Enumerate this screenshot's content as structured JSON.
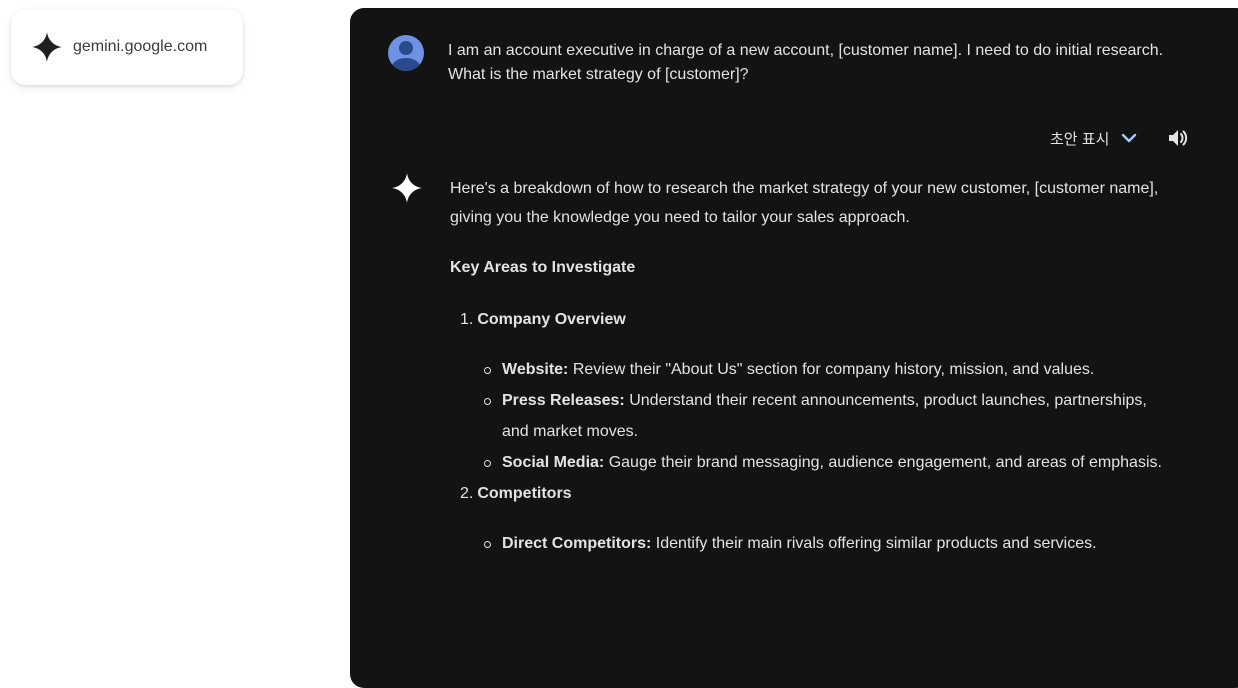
{
  "site_chip": {
    "icon": "gemini-spark-icon",
    "domain": "gemini.google.com"
  },
  "conversation": {
    "user_prompt": "I am an account executive in charge of a new account, [customer name]. I need to do initial research. What is the market strategy of [customer]?",
    "draft_label": "초안 표시",
    "response": {
      "intro": "Here's a breakdown of how to research the market strategy of your new customer, [customer name], giving you the knowledge you need to tailor your sales approach.",
      "heading": "Key Areas to Investigate",
      "sections": [
        {
          "number": "1.",
          "title": "Company Overview",
          "bullets": [
            {
              "term": "Website:",
              "text": " Review their \"About Us\" section for company history, mission, and values."
            },
            {
              "term": "Press Releases:",
              "text": " Understand their recent announcements, product launches, partnerships, and market moves."
            },
            {
              "term": "Social Media:",
              "text": " Gauge their brand messaging, audience engagement, and areas of emphasis."
            }
          ]
        },
        {
          "number": "2.",
          "title": "Competitors",
          "bullets": [
            {
              "term": "Direct Competitors:",
              "text": " Identify their main rivals offering similar products and services."
            }
          ]
        }
      ]
    }
  },
  "colors": {
    "panel_bg": "#131314",
    "text": "#e3e3e3",
    "accent_blue": "#a8c7fa",
    "avatar": "#6f93e2"
  }
}
